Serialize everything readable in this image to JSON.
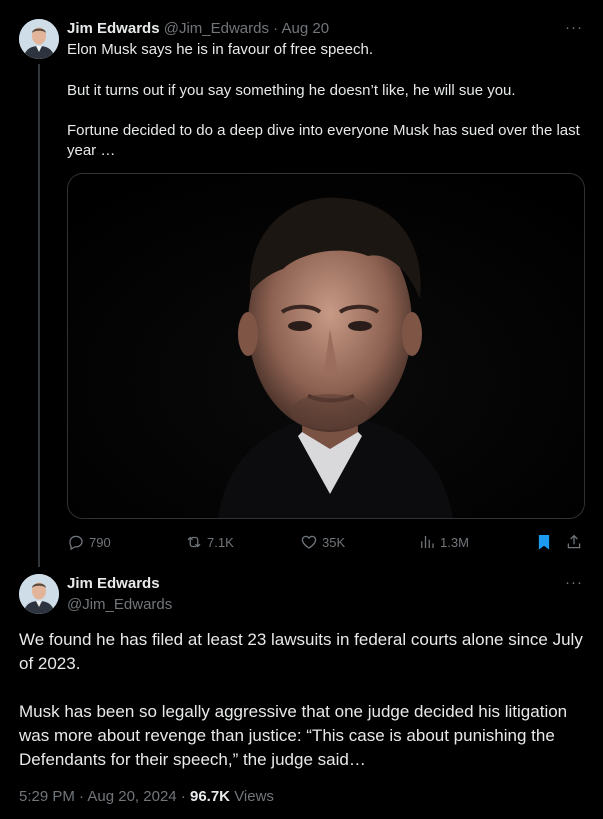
{
  "tweet1": {
    "author_name": "Jim Edwards",
    "handle": "@Jim_Edwards",
    "separator": "·",
    "date": "Aug 20",
    "more_label": "···",
    "paragraphs": [
      "Elon Musk says he is in favour of free speech.",
      "But it turns out if you say something he doesn’t like, he will sue you.",
      "Fortune decided to do a deep dive into everyone Musk has sued over the last year …"
    ],
    "stats": {
      "replies": "790",
      "reposts": "7.1K",
      "likes": "35K",
      "views": "1.3M"
    },
    "colors": {
      "bookmark_active": "#1d9bf0",
      "muted": "#71767b"
    },
    "icons": [
      "reply-icon",
      "repost-icon",
      "like-icon",
      "views-icon",
      "bookmark-icon",
      "share-icon"
    ]
  },
  "tweet2": {
    "author_name": "Jim Edwards",
    "handle": "@Jim_Edwards",
    "more_label": "···",
    "paragraphs": [
      "We found he has filed at least 23 lawsuits in federal courts alone since July of 2023.",
      "Musk has been so legally aggressive that one judge decided his litigation was more about revenge than justice: “This case is about punishing the Defendants for their speech,” the judge said…"
    ],
    "time": "5:29 PM",
    "separator": "·",
    "date": "Aug 20, 2024",
    "separator2": "·",
    "views_count": "96.7K",
    "views_label": "Views"
  }
}
